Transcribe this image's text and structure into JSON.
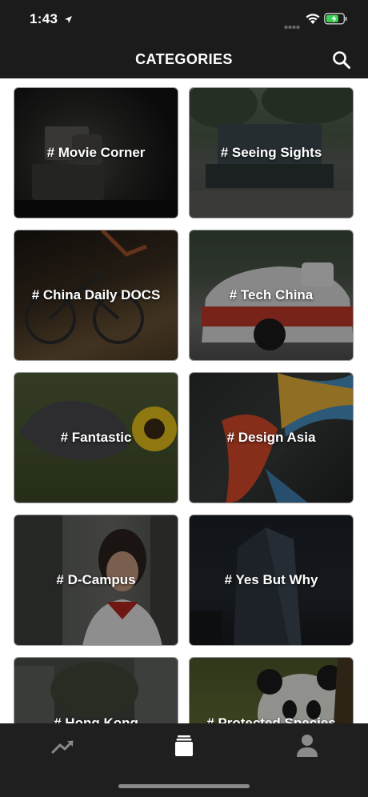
{
  "status_bar": {
    "time": "1:43",
    "icons": [
      "location-arrow-icon",
      "signal-icon",
      "wifi-icon",
      "battery-icon"
    ]
  },
  "header": {
    "title": "CATEGORIES",
    "search_icon": "search-icon"
  },
  "categories": [
    {
      "label": "# Movie Corner"
    },
    {
      "label": "# Seeing Sights"
    },
    {
      "label": "# China Daily DOCS"
    },
    {
      "label": "# Tech China"
    },
    {
      "label": "# Fantastic"
    },
    {
      "label": "# Design Asia"
    },
    {
      "label": "# D-Campus"
    },
    {
      "label": "# Yes But Why"
    },
    {
      "label": "# Hong Kong"
    },
    {
      "label": "# Protected Species"
    }
  ],
  "tab_bar": {
    "tabs": [
      {
        "name": "trending-icon",
        "active": false
      },
      {
        "name": "stack-icon",
        "active": true
      },
      {
        "name": "profile-icon",
        "active": false
      }
    ]
  },
  "colors": {
    "bar_background": "#1b1b1b",
    "tab_active": "#ffffff",
    "tab_inactive": "#8a8a8a"
  }
}
